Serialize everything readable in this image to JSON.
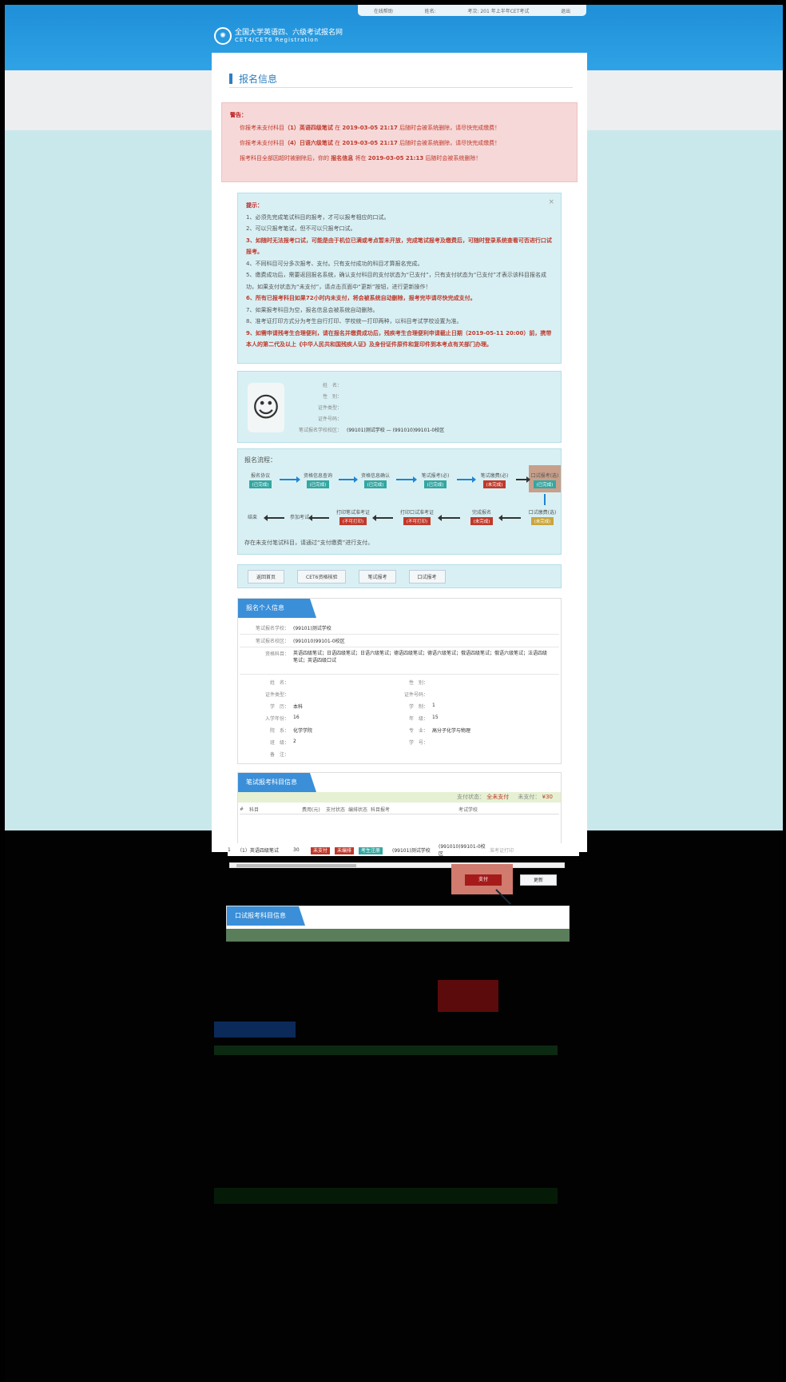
{
  "topbar": {
    "links": [
      "在线帮助",
      "姓名:",
      "考次: 201 年上半年CET考试",
      "退出"
    ]
  },
  "header": {
    "title": "全国大学英语四、六级考试报名网",
    "subtitle": "CET4/CET6  Registration"
  },
  "page_title": "报名信息",
  "warning": {
    "title": "警告：",
    "lines": [
      {
        "pre": "你报考未支付科目",
        "subject": "（1）英语四级笔试",
        "mid": "在",
        "time": "2019-03-05 21:17",
        "post": "后随时会被系统删除，请尽快完成缴费！"
      },
      {
        "pre": "你报考未支付科目",
        "subject": "（4）日语六级笔试",
        "mid": "在",
        "time": "2019-03-05 21:17",
        "post": "后随时会被系统删除，请尽快完成缴费！"
      },
      {
        "pre": "报考科目全部因超时被删除后，你的",
        "subject": "报名信息",
        "mid": "将在",
        "time": "2019-03-05 21:13",
        "post": "后随时会被系统删除！"
      }
    ]
  },
  "tips": {
    "title": "提示：",
    "items": [
      {
        "text": "1、必须先完成笔试科目的报考，才可以报考相应的口试。",
        "red": false
      },
      {
        "text": "2、可以只报考笔试，但不可以只报考口试。",
        "red": false
      },
      {
        "text": "3、如随时无法报考口试，可能是由于机位已满或考点暂未开放，完成笔试报考及缴费后，可随时登录系统查看可否进行口试报考。",
        "red": true
      },
      {
        "text": "4、不同科目可分多次报考、支付。只有支付成功的科目才算报名完成。",
        "red": false
      },
      {
        "text": "5、缴费成功后，需要返回报名系统，确认支付科目的支付状态为“已支付”，只有支付状态为“已支付”才表示该科目报名成功，如果支付状态为“未支付”，请点击页面中“更新”按钮，进行更新操作！",
        "red": false
      },
      {
        "text": "6、所有已报考科目如果72小时内未支付，将会被系统自动删除，报考完毕请尽快完成支付。",
        "red": true
      },
      {
        "text": "7、如果报考科目为空，报名信息会被系统自动删除。",
        "red": false
      },
      {
        "text": "8、准考证打印方式分为考生自行打印、学校统一打印两种，以科目考试学校设置为准。",
        "red": false
      },
      {
        "text": "9、如需申请残考生合理便利，请在报名并缴费成功后，残疾考生合理便利申请截止日期（2019-05-11 20:00）前，携带本人的第二代及以上《中华人民共和国残疾人证》及身份证件原件和复印件到本考点有关部门办理。",
        "red": true
      }
    ],
    "close": "×"
  },
  "profile": {
    "rows": [
      {
        "k": "姓　名：",
        "v": ""
      },
      {
        "k": "性　别：",
        "v": ""
      },
      {
        "k": "证件类型：",
        "v": ""
      },
      {
        "k": "证件号码：",
        "v": ""
      },
      {
        "k": "笔试报名学校校区：",
        "v": "(99101)测试学校 — (991010)99101-0校区"
      }
    ]
  },
  "flow": {
    "title": "报名流程：",
    "steps_top": [
      {
        "label": "报名协议",
        "status": "(已完成)"
      },
      {
        "label": "资格信息查询",
        "status": "(已完成)"
      },
      {
        "label": "资格信息确认",
        "status": "(已完成)"
      },
      {
        "label": "笔试报考(必)",
        "status": "(已完成)"
      },
      {
        "label": "笔试缴费(必)",
        "status": "(未完成)"
      },
      {
        "label": "口试报考(选)",
        "status": "(已完成)"
      }
    ],
    "steps_bottom": [
      {
        "label": "口试缴费(选)",
        "status": "(未完成)"
      },
      {
        "label": "完成报名",
        "status": "(未完成)"
      },
      {
        "label": "打印口试准考证",
        "status": "(不可打印)"
      },
      {
        "label": "打印笔试准考证",
        "status": "(不可打印)"
      },
      {
        "label": "参加考试",
        "status": ""
      },
      {
        "label": "结束",
        "status": ""
      }
    ],
    "note": "存在未支付笔试科目，请通过“支付缴费”进行支付。"
  },
  "buttons": [
    "返回首页",
    "CET6资格核验",
    "笔试报考",
    "口试报考"
  ],
  "personal": {
    "header": "报名个人信息",
    "school": {
      "k": "笔试报名学校：",
      "v": "(99101)测试学校"
    },
    "campus": {
      "k": "笔试报名校区：",
      "v": "(991010)99101-0校区"
    },
    "subjects": {
      "k": "资格科目：",
      "v": "英语四级笔试；日语四级笔试；日语六级笔试；德语四级笔试；德语六级笔试；俄语四级笔试；俄语六级笔试；法语四级笔试；英语四级口试"
    },
    "left": [
      {
        "k": "姓　名：",
        "v": ""
      },
      {
        "k": "证件类型：",
        "v": ""
      },
      {
        "k": "学　历：",
        "v": "本科"
      },
      {
        "k": "入学年份：",
        "v": "16"
      },
      {
        "k": "院　系：",
        "v": "化学学院"
      },
      {
        "k": "班　级：",
        "v": "2"
      },
      {
        "k": "备　注：",
        "v": ""
      }
    ],
    "right": [
      {
        "k": "性　别：",
        "v": ""
      },
      {
        "k": "证件号码：",
        "v": ""
      },
      {
        "k": "学　制：",
        "v": "1"
      },
      {
        "k": "年　级：",
        "v": "15"
      },
      {
        "k": "专　业：",
        "v": "高分子化学与物理"
      },
      {
        "k": "学　号：",
        "v": ""
      }
    ]
  },
  "written": {
    "header": "笔试报考科目信息",
    "pay_label": "支付状态：",
    "pay_status": "全未支付",
    "unpaid_label": "未支付：",
    "unpaid_amount": "¥30",
    "columns": [
      "#",
      "科目",
      "费用(元)",
      "支付状态",
      "编排状态",
      "科目报考",
      "考试学校"
    ],
    "row": {
      "no": "1",
      "subject": "（1）英语四级笔试",
      "fee": "30",
      "pay": "未支付",
      "arrange": "未编排",
      "apply": "考生注册",
      "school": "(99101)测试学校",
      "campus": "(991010)99101-0校区",
      "more": "准考证打印"
    },
    "pay_button": "支付",
    "refresh_button": "更新"
  },
  "oral": {
    "header": "口试报考科目信息"
  },
  "colors": {
    "accent": "#2d7fc0",
    "danger": "#c0392b",
    "success": "#34a7a1"
  }
}
